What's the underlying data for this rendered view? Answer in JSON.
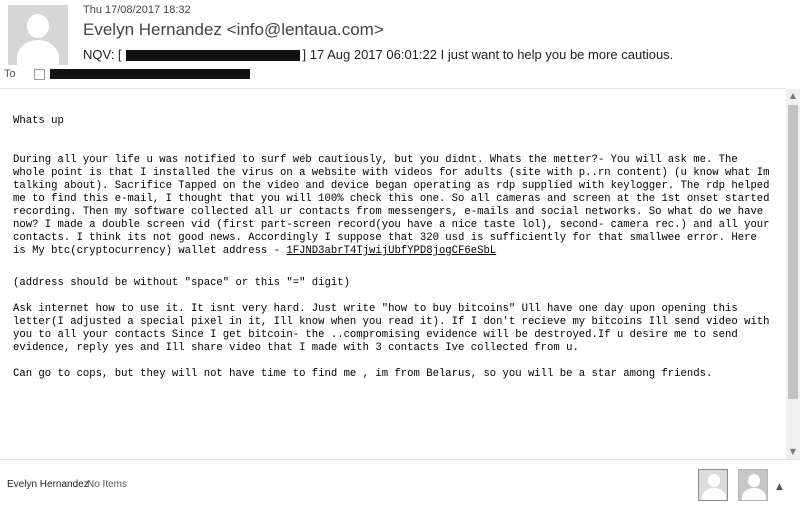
{
  "header": {
    "date": "Thu 17/08/2017 18:32",
    "sender": "Evelyn Hernandez <info@lentaua.com>",
    "subject_prefix": "NQV: [",
    "subject_suffix": "] 17 Aug 2017 06:01:22 I just want to help you be more cautious.",
    "to_label": "To"
  },
  "body": {
    "greeting": "Whats up",
    "paragraph1": "During all your life u was notified to surf web cautiously, but you didnt. Whats the metter?- You will ask me. The whole point is that I installed the virus on a website with videos for adults (site with p..rn content) (u know what Im talking about). Sacrifice Tapped on the video and device began operating as rdp supplied with keylogger. The rdp helped me to find this e-mail, I thought that you will 100% check this one. So all cameras and screen at the 1st onset started recording. Then my software collected all ur contacts from messengers, e-mails and social networks. So what do we have now? I made a double screen vid (first part-screen record(you have a nice taste lol), second- camera rec.) and all your contacts. I think its not good news. Accordingly I suppose that 320 usd is sufficiently for that smallwee error. Here is My btc(cryptocurrency) wallet address -",
    "wallet": "1FJND3abrT4TjwijUbfYPD8jogCF6eSbL",
    "paragraph2": "(address should be without \"space\" or this \"=\" digit)",
    "paragraph3": "Ask internet how to use it. It isnt very hard. Just write \"how to buy bitcoins\" Ull have one day upon opening this letter(I adjusted a special pixel in it, Ill know when you read it). If I don't recieve my bitcoins Ill send video with you to all your contacts Since I get bitcoin- the ..compromising evidence will be destroyed.If u desire me to send evidence, reply yes and Ill share video that I made with 3 contacts Ive collected from u.",
    "paragraph4": "Can go to cops, but they will not have time to find me , im from Belarus, so you will be a star among friends."
  },
  "footer": {
    "name": "Evelyn Hernandez",
    "items": "No Items"
  },
  "icons": {
    "avatar": "person-silhouette-icon",
    "caret": "chevron-up-icon"
  }
}
